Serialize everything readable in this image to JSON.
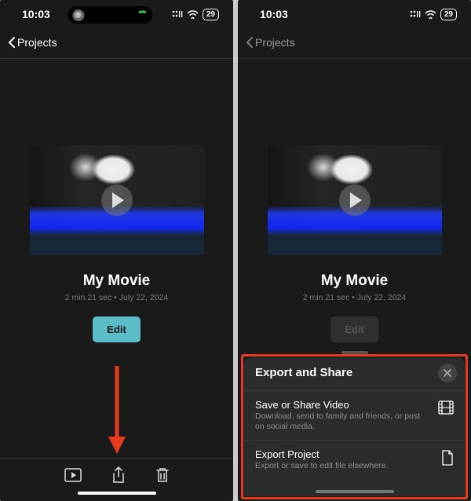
{
  "status": {
    "time": "10:03",
    "battery": "29"
  },
  "nav": {
    "back_label": "Projects"
  },
  "project": {
    "title": "My Movie",
    "duration": "2 min 21 sec",
    "date": "July 22, 2024",
    "edit_label": "Edit"
  },
  "sheet": {
    "title": "Export and Share",
    "items": [
      {
        "title": "Save or Share Video",
        "desc": "Download, send to family and friends, or post on social media.",
        "icon": "film-icon"
      },
      {
        "title": "Export Project",
        "desc": "Export or save to edit file elsewhere.",
        "icon": "document-icon"
      }
    ]
  }
}
